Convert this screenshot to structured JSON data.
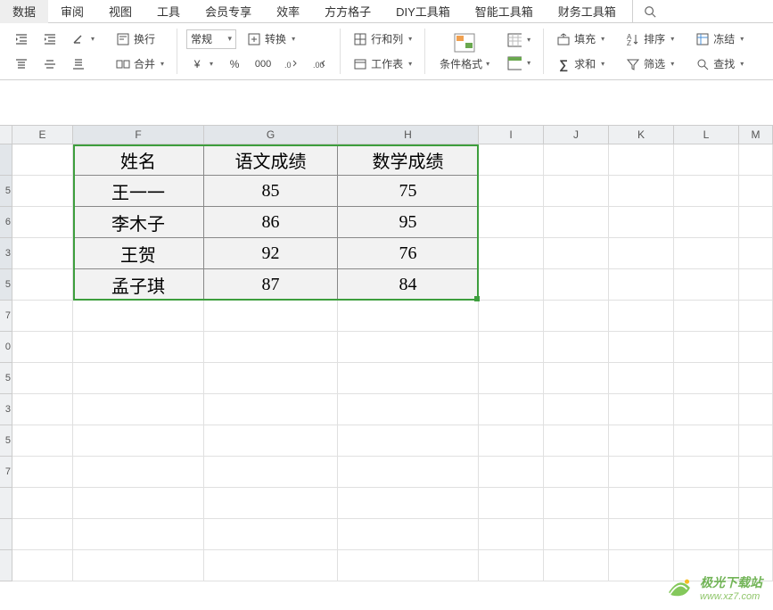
{
  "menu": [
    "数据",
    "审阅",
    "视图",
    "工具",
    "会员专享",
    "效率",
    "方方格子",
    "DIY工具箱",
    "智能工具箱",
    "财务工具箱"
  ],
  "toolbar": {
    "wrap": "换行",
    "merge": "合并",
    "format_value": "常规",
    "convert": "转换",
    "rowcol": "行和列",
    "sheet": "工作表",
    "condfmt": "条件格式",
    "fill": "填充",
    "sum": "求和",
    "sort": "排序",
    "filter": "筛选",
    "freeze": "冻结",
    "find": "查找"
  },
  "columns": [
    "E",
    "F",
    "G",
    "H",
    "I",
    "J",
    "K",
    "L",
    "M"
  ],
  "row_numbers": [
    "",
    "5",
    "6",
    "3",
    "5",
    "7",
    "0",
    "5",
    "3",
    "5",
    "7"
  ],
  "chart_data": {
    "type": "table",
    "headers": [
      "姓名",
      "语文成绩",
      "数学成绩"
    ],
    "rows": [
      {
        "name": "王一一",
        "chinese": 85,
        "math": 75
      },
      {
        "name": "李木子",
        "chinese": 86,
        "math": 95
      },
      {
        "name": "王贺",
        "chinese": 92,
        "math": 76
      },
      {
        "name": "孟子琪",
        "chinese": 87,
        "math": 84
      }
    ]
  },
  "watermark": {
    "cn": "极光下载站",
    "en": "www.xz7.com"
  }
}
